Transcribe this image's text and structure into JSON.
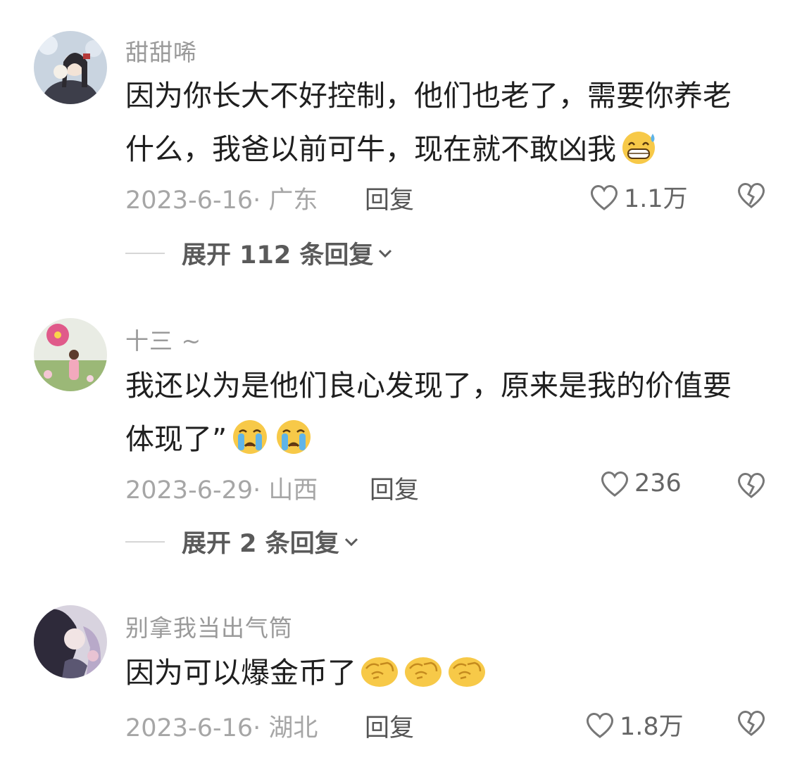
{
  "comments": [
    {
      "username": "甜甜唏",
      "text_line1": "因为你长大不好控制，他们也老了，需要你养老",
      "text_line2": "什么，我爸以前可牛，现在就不敢凶我",
      "emoji": "sweat-grin-emoji",
      "date_location": "2023-6-16· 广东",
      "reply_label": "回复",
      "likes": "1.1万",
      "expand_label": "展开 112 条回复"
    },
    {
      "username": "十三 ~",
      "text_line1": "我还以为是他们良心发现了，原来是我的价值要",
      "text_line2": "体现了”",
      "emoji": "crying-emoji",
      "date_location": "2023-6-29· 山西",
      "reply_label": "回复",
      "likes": "236",
      "expand_label": "展开 2 条回复"
    },
    {
      "username": "别拿我当出气筒",
      "text_line1": "因为可以爆金币了",
      "emoji": "fist-bump-emoji",
      "date_location": "2023-6-16· 湖北",
      "reply_label": "回复",
      "likes": "1.8万"
    }
  ],
  "icons": {
    "like": "heart-outline-icon",
    "dislike": "broken-heart-icon",
    "expand": "chevron-down-icon"
  },
  "colors": {
    "username": "#9a9a9a",
    "meta": "#a6a6a6",
    "text": "#1f1f1f"
  }
}
